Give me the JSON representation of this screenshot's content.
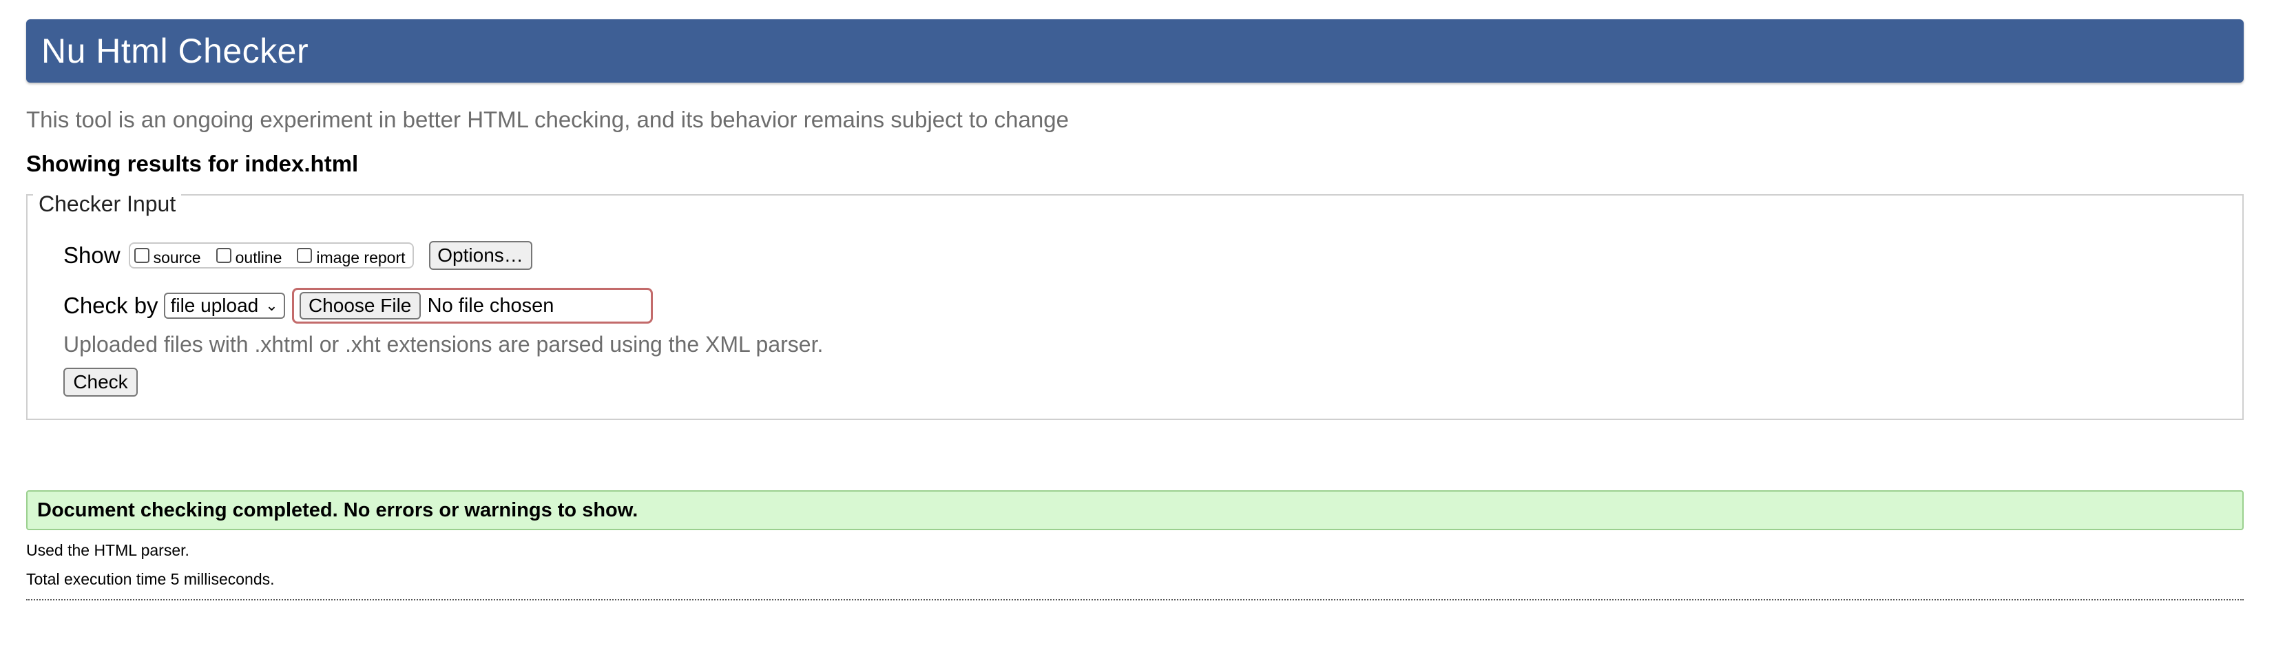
{
  "header": {
    "title": "Nu Html Checker"
  },
  "intro_text": "This tool is an ongoing experiment in better HTML checking, and its behavior remains subject to change",
  "results_heading": "Showing results for index.html",
  "checker_input": {
    "legend": "Checker Input",
    "show_label": "Show",
    "options": [
      {
        "label": "source",
        "checked": false
      },
      {
        "label": "outline",
        "checked": false
      },
      {
        "label": "image report",
        "checked": false
      }
    ],
    "options_button": "Options…",
    "check_by_label": "Check by",
    "check_by_selected": "file upload",
    "choose_file_button": "Choose File",
    "file_status": "No file chosen",
    "upload_note": "Uploaded files with .xhtml or .xht extensions are parsed using the XML parser.",
    "check_button": "Check"
  },
  "result": {
    "success_message": "Document checking completed. No errors or warnings to show.",
    "parser_note": "Used the HTML parser.",
    "execution_time": "Total execution time 5 milliseconds."
  },
  "colors": {
    "header_bg": "#3e5f95",
    "success_bg": "#d8f8d2",
    "file_input_border": "#c36b6b"
  }
}
